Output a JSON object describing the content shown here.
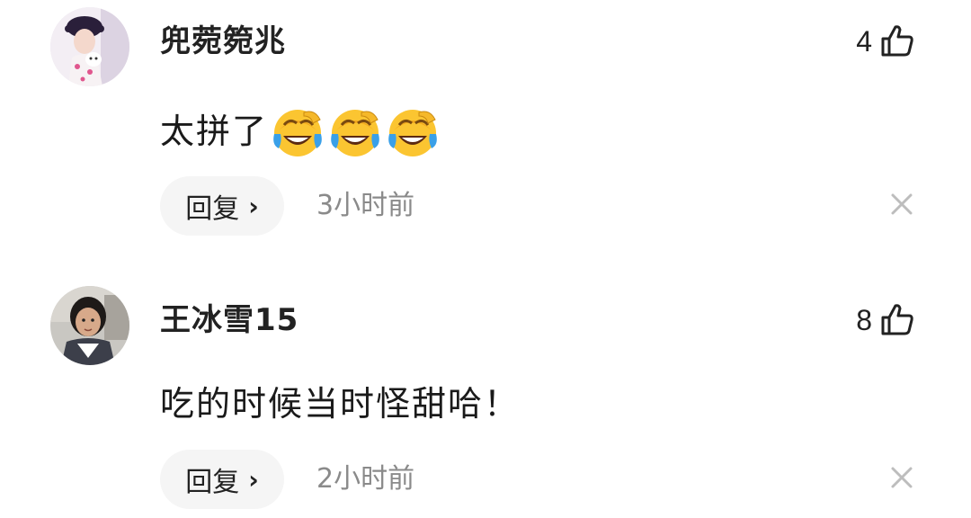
{
  "comments": [
    {
      "username": "兜菀箢兆",
      "likes": "4",
      "text": "太拼了",
      "emojis": [
        "laughing-crying-emoji",
        "laughing-crying-emoji",
        "laughing-crying-emoji"
      ],
      "reply_label": "回复",
      "reply_chevron": "›",
      "time": "3小时前"
    },
    {
      "username": "王冰雪15",
      "likes": "8",
      "text": "吃的时候当时怪甜哈！",
      "emojis": [],
      "reply_label": "回复",
      "reply_chevron": "›",
      "time": "2小时前"
    }
  ],
  "icons": {
    "like": "thumbs-up-icon",
    "close": "close-icon"
  },
  "colors": {
    "text_primary": "#1a1a1a",
    "text_secondary": "#8a8a8a",
    "reply_bg": "#f5f5f5",
    "close_icon": "#bdbdbd"
  }
}
